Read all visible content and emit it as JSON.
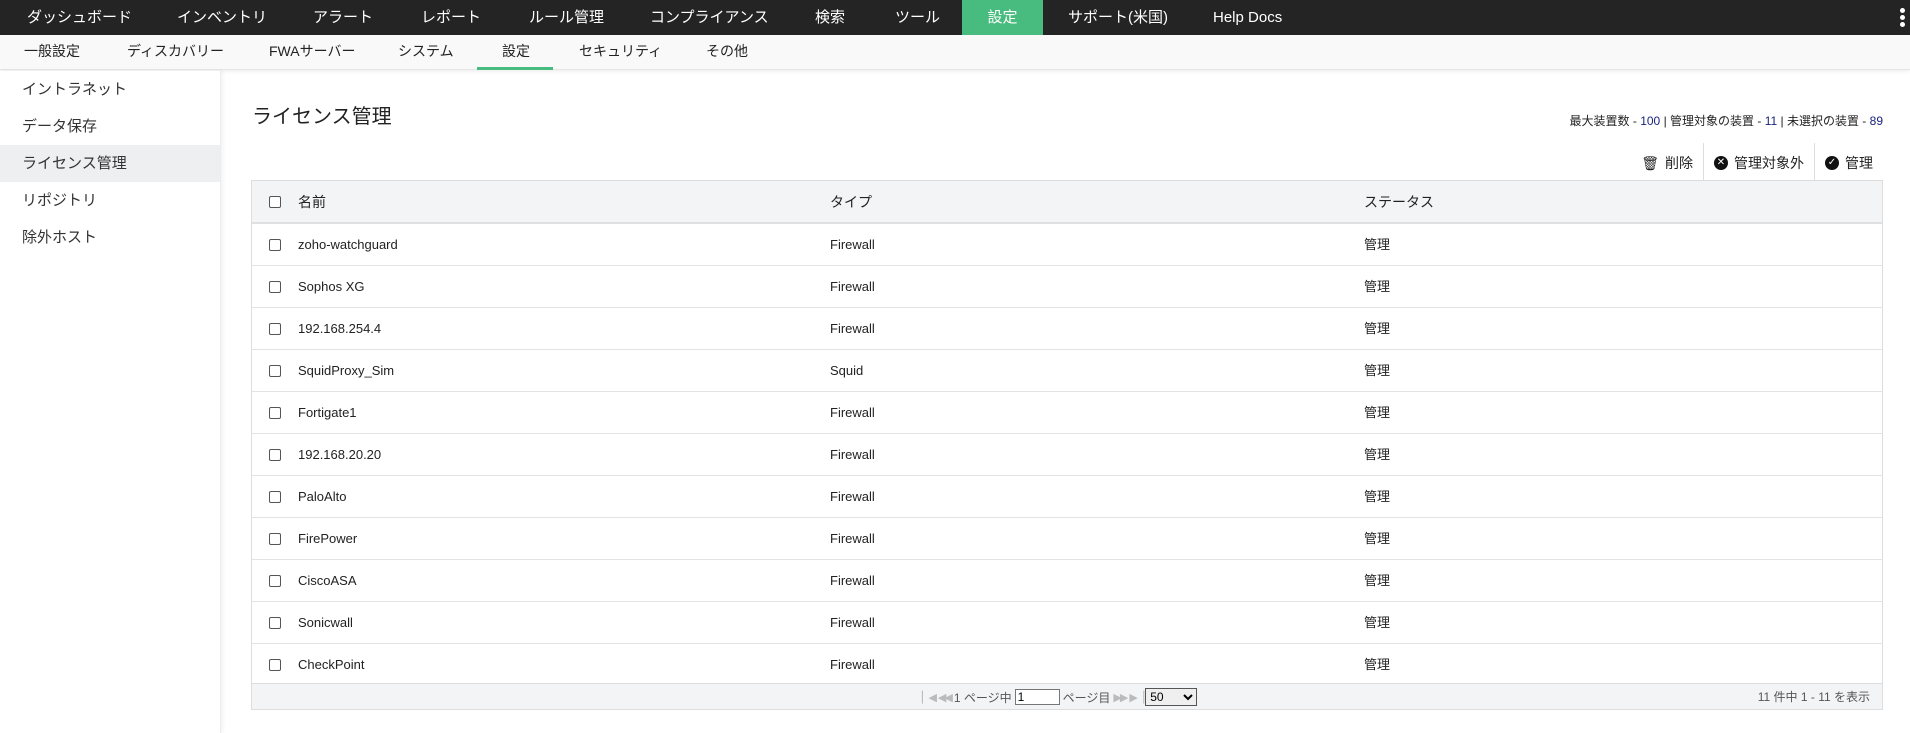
{
  "topnav": {
    "items": [
      "ダッシュボード",
      "インベントリ",
      "アラート",
      "レポート",
      "ルール管理",
      "コンプライアンス",
      "検索",
      "ツール",
      "設定",
      "サポート(米国)",
      "Help Docs"
    ],
    "active": "設定",
    "accent": "#48bb7e"
  },
  "subnav": {
    "items": [
      "一般設定",
      "ディスカバリー",
      "FWAサーバー",
      "システム",
      "設定",
      "セキュリティ",
      "その他"
    ],
    "active": "設定"
  },
  "sidebar": {
    "items": [
      "イントラネット",
      "データ保存",
      "ライセンス管理",
      "リポジトリ",
      "除外ホスト"
    ],
    "selected": "ライセンス管理"
  },
  "page": {
    "title": "ライセンス管理",
    "stats": {
      "max_label": "最大装置数 - ",
      "max": "100",
      "sep": " | ",
      "managed_label": "管理対象の装置 - ",
      "managed": "11",
      "unselected_label": "未選択の装置 - ",
      "unselected": "89"
    },
    "actions": {
      "delete": "削除",
      "unmanage": "管理対象外",
      "manage": "管理"
    }
  },
  "table": {
    "headers": [
      "名前",
      "タイプ",
      "ステータス"
    ],
    "rows": [
      [
        "zoho-watchguard",
        "Firewall",
        "管理"
      ],
      [
        "Sophos XG",
        "Firewall",
        "管理"
      ],
      [
        "192.168.254.4",
        "Firewall",
        "管理"
      ],
      [
        "SquidProxy_Sim",
        "Squid",
        "管理"
      ],
      [
        "Fortigate1",
        "Firewall",
        "管理"
      ],
      [
        "192.168.20.20",
        "Firewall",
        "管理"
      ],
      [
        "PaloAlto",
        "Firewall",
        "管理"
      ],
      [
        "FirePower",
        "Firewall",
        "管理"
      ],
      [
        "CiscoASA",
        "Firewall",
        "管理"
      ],
      [
        "Sonicwall",
        "Firewall",
        "管理"
      ],
      [
        "CheckPoint",
        "Firewall",
        "管理"
      ]
    ]
  },
  "pagination": {
    "page_of": "1 ページ中",
    "page_value": "1",
    "page_suffix": "ページ目",
    "per_page": "50",
    "count": "11 件中 1 - 11 を表示"
  }
}
